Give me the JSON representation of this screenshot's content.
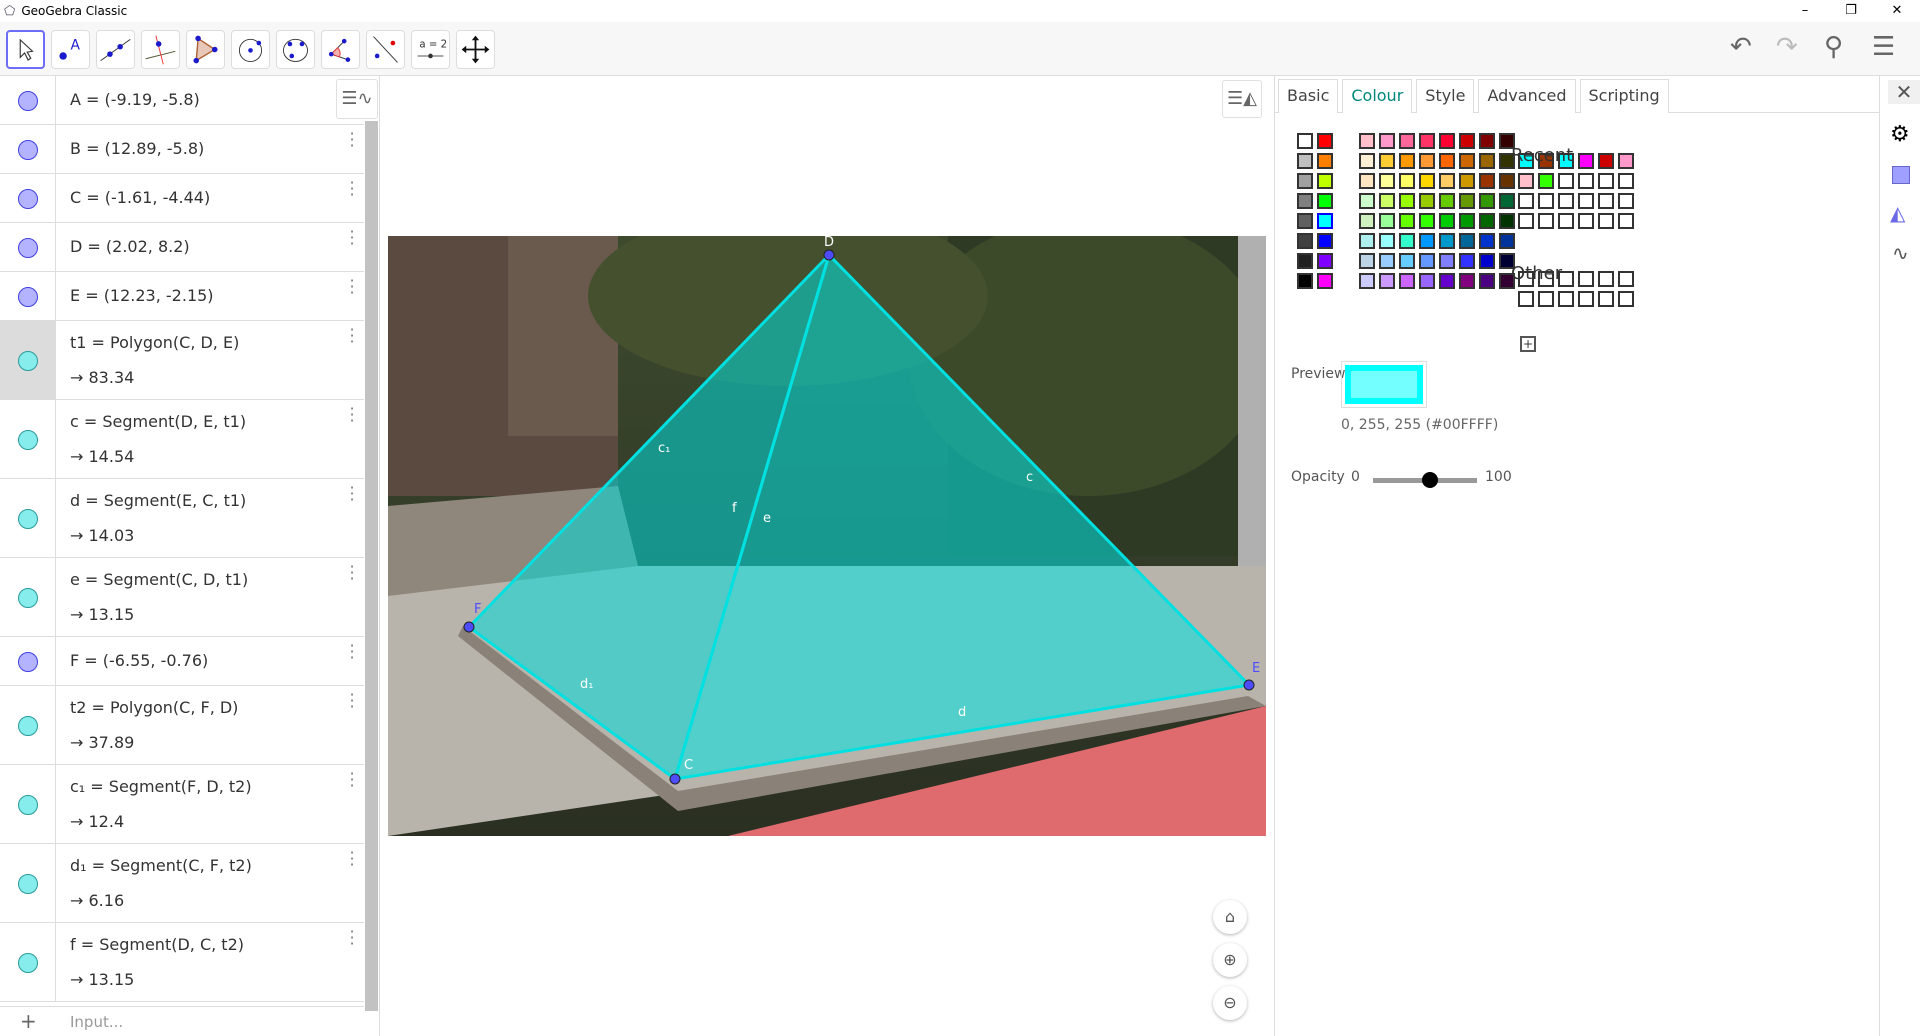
{
  "window": {
    "title": "GeoGebra Classic",
    "minimize": "–",
    "restore": "❐",
    "close": "✕"
  },
  "toolbar": {
    "tools": [
      "move-tool",
      "point-tool",
      "line-tool",
      "perpendicular-line-tool",
      "polygon-tool",
      "circle-tool",
      "conic-tool",
      "angle-tool",
      "reflect-tool",
      "slider-tool",
      "move-graphics-tool"
    ],
    "slider_label": "a = 2",
    "undo": "↶",
    "redo": "↷",
    "search": "⚲",
    "menu": "☰"
  },
  "algebra": {
    "rows": [
      {
        "name": "A",
        "def": "A = (-9.19, -5.8)",
        "type": "point"
      },
      {
        "name": "B",
        "def": "B = (12.89, -5.8)",
        "type": "point"
      },
      {
        "name": "C",
        "def": "C = (-1.61, -4.44)",
        "type": "point"
      },
      {
        "name": "D",
        "def": "D = (2.02, 8.2)",
        "type": "point"
      },
      {
        "name": "E",
        "def": "E = (12.23, -2.15)",
        "type": "point"
      },
      {
        "name": "t1",
        "def": "t1 = Polygon(C, D, E)",
        "value": "→  83.34",
        "type": "seg",
        "highlight": true
      },
      {
        "name": "c",
        "def": "c = Segment(D, E, t1)",
        "value": "→  14.54",
        "type": "seg"
      },
      {
        "name": "d",
        "def": "d = Segment(E, C, t1)",
        "value": "→  14.03",
        "type": "seg"
      },
      {
        "name": "e",
        "def": "e = Segment(C, D, t1)",
        "value": "→  13.15",
        "type": "seg"
      },
      {
        "name": "F",
        "def": "F = (-6.55, -0.76)",
        "type": "point"
      },
      {
        "name": "t2",
        "def": "t2 = Polygon(C, F, D)",
        "value": "→  37.89",
        "type": "seg"
      },
      {
        "name": "c1",
        "def": "c₁ = Segment(F, D, t2)",
        "value": "→  12.4",
        "type": "seg"
      },
      {
        "name": "d1",
        "def": "d₁ = Segment(C, F, t2)",
        "value": "→  6.16",
        "type": "seg"
      },
      {
        "name": "f",
        "def": "f = Segment(D, C, t2)",
        "value": "→  13.15",
        "type": "seg"
      }
    ],
    "input_placeholder": "Input...",
    "add": "+"
  },
  "graphics": {
    "labels": {
      "D": "D",
      "C": "C",
      "E": "E",
      "F": "F",
      "c": "c",
      "d": "d",
      "e": "e",
      "f": "f",
      "c1": "c₁",
      "d1": "d₁"
    },
    "home": "⌂",
    "zoom_in": "⊕",
    "zoom_out": "⊖"
  },
  "properties": {
    "tabs": [
      "Basic",
      "Colour",
      "Style",
      "Advanced",
      "Scripting"
    ],
    "active_tab": "Colour",
    "close": "✕",
    "recent_label": "Recent",
    "other_label": "Other",
    "add_custom": "+",
    "preview_label": "Preview",
    "color_value": "0, 255, 255 (#00FFFF)",
    "selected_color": "#00FFFF",
    "opacity_label": "Opacity",
    "opacity_min": "0",
    "opacity_max": "100",
    "opacity_value": 55,
    "gray_col": [
      "#ffffff",
      "#c0c0c0",
      "#a0a0a0",
      "#808080",
      "#606060",
      "#404040",
      "#202020",
      "#000000"
    ],
    "primary_col": [
      "#ff0000",
      "#ff7f00",
      "#bfff00",
      "#00ff00",
      "#00ffff",
      "#0000ff",
      "#7f00ff",
      "#ff00ff"
    ],
    "palette": [
      [
        "#ffc0cb",
        "#ff99cc",
        "#ff6699",
        "#ff3366",
        "#ff0033",
        "#cc0000",
        "#800000",
        "#330000"
      ],
      [
        "#ffefd5",
        "#ffcc33",
        "#ff9900",
        "#ff9933",
        "#ff6600",
        "#cc6600",
        "#996600",
        "#333300"
      ],
      [
        "#ffe4c4",
        "#ffff99",
        "#ffff66",
        "#ffd700",
        "#ffcc66",
        "#cc9900",
        "#993300",
        "#663300"
      ],
      [
        "#ccffcc",
        "#ccff66",
        "#99ff00",
        "#99cc00",
        "#66cc00",
        "#669900",
        "#339900",
        "#006633"
      ],
      [
        "#d0f0c0",
        "#99ff99",
        "#66ff00",
        "#33ff00",
        "#00cc00",
        "#009900",
        "#006600",
        "#003300"
      ],
      [
        "#afeeee",
        "#99ffff",
        "#33ffcc",
        "#0099ff",
        "#0099cc",
        "#006699",
        "#0033cc",
        "#003399"
      ],
      [
        "#bcd4e6",
        "#99ccff",
        "#66ccff",
        "#6699ff",
        "#7f7fff",
        "#3333ff",
        "#0000cc",
        "#000033"
      ],
      [
        "#ccccff",
        "#cc99ff",
        "#cc66ff",
        "#9966ff",
        "#6600cc",
        "#800080",
        "#4b0082",
        "#330033"
      ]
    ],
    "recent": [
      "#00ffff",
      "#993300",
      "#00ffff",
      "#ff00ff",
      "#cc0000",
      "#ff99cc",
      "#ffc0cb",
      "#33ff00",
      "#ffffff",
      "#ffffff",
      "#ffffff",
      "#ffffff",
      "#ffffff",
      "#ffffff",
      "#ffffff",
      "#ffffff",
      "#ffffff",
      "#ffffff",
      "#ffffff",
      "#ffffff",
      "#ffffff",
      "#ffffff",
      "#ffffff",
      "#ffffff"
    ],
    "other": [
      "#ffffff",
      "#ffffff",
      "#ffffff",
      "#ffffff",
      "#ffffff",
      "#ffffff",
      "#ffffff",
      "#ffffff",
      "#ffffff",
      "#ffffff",
      "#ffffff",
      "#ffffff"
    ]
  },
  "sidebar": {
    "icons": [
      "gear-icon",
      "graphics-icon",
      "geometry-icon",
      "algebra-graph-icon"
    ]
  }
}
